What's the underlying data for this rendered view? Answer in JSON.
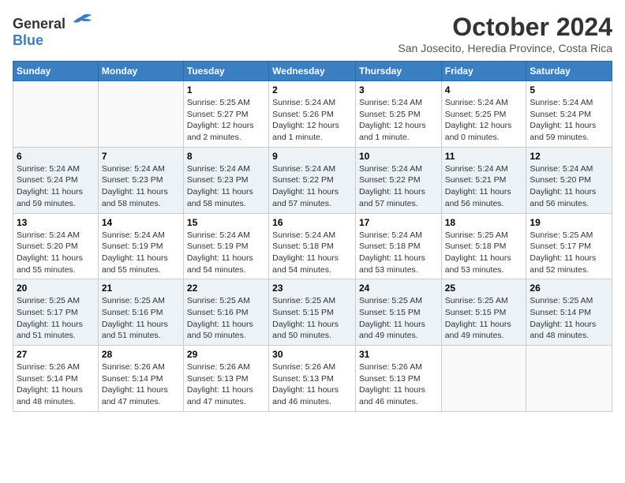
{
  "logo": {
    "general": "General",
    "blue": "Blue"
  },
  "title": "October 2024",
  "location": "San Josecito, Heredia Province, Costa Rica",
  "days_of_week": [
    "Sunday",
    "Monday",
    "Tuesday",
    "Wednesday",
    "Thursday",
    "Friday",
    "Saturday"
  ],
  "weeks": [
    [
      {
        "day": "",
        "detail": ""
      },
      {
        "day": "",
        "detail": ""
      },
      {
        "day": "1",
        "detail": "Sunrise: 5:25 AM\nSunset: 5:27 PM\nDaylight: 12 hours and 2 minutes."
      },
      {
        "day": "2",
        "detail": "Sunrise: 5:24 AM\nSunset: 5:26 PM\nDaylight: 12 hours and 1 minute."
      },
      {
        "day": "3",
        "detail": "Sunrise: 5:24 AM\nSunset: 5:25 PM\nDaylight: 12 hours and 1 minute."
      },
      {
        "day": "4",
        "detail": "Sunrise: 5:24 AM\nSunset: 5:25 PM\nDaylight: 12 hours and 0 minutes."
      },
      {
        "day": "5",
        "detail": "Sunrise: 5:24 AM\nSunset: 5:24 PM\nDaylight: 11 hours and 59 minutes."
      }
    ],
    [
      {
        "day": "6",
        "detail": "Sunrise: 5:24 AM\nSunset: 5:24 PM\nDaylight: 11 hours and 59 minutes."
      },
      {
        "day": "7",
        "detail": "Sunrise: 5:24 AM\nSunset: 5:23 PM\nDaylight: 11 hours and 58 minutes."
      },
      {
        "day": "8",
        "detail": "Sunrise: 5:24 AM\nSunset: 5:23 PM\nDaylight: 11 hours and 58 minutes."
      },
      {
        "day": "9",
        "detail": "Sunrise: 5:24 AM\nSunset: 5:22 PM\nDaylight: 11 hours and 57 minutes."
      },
      {
        "day": "10",
        "detail": "Sunrise: 5:24 AM\nSunset: 5:22 PM\nDaylight: 11 hours and 57 minutes."
      },
      {
        "day": "11",
        "detail": "Sunrise: 5:24 AM\nSunset: 5:21 PM\nDaylight: 11 hours and 56 minutes."
      },
      {
        "day": "12",
        "detail": "Sunrise: 5:24 AM\nSunset: 5:20 PM\nDaylight: 11 hours and 56 minutes."
      }
    ],
    [
      {
        "day": "13",
        "detail": "Sunrise: 5:24 AM\nSunset: 5:20 PM\nDaylight: 11 hours and 55 minutes."
      },
      {
        "day": "14",
        "detail": "Sunrise: 5:24 AM\nSunset: 5:19 PM\nDaylight: 11 hours and 55 minutes."
      },
      {
        "day": "15",
        "detail": "Sunrise: 5:24 AM\nSunset: 5:19 PM\nDaylight: 11 hours and 54 minutes."
      },
      {
        "day": "16",
        "detail": "Sunrise: 5:24 AM\nSunset: 5:18 PM\nDaylight: 11 hours and 54 minutes."
      },
      {
        "day": "17",
        "detail": "Sunrise: 5:24 AM\nSunset: 5:18 PM\nDaylight: 11 hours and 53 minutes."
      },
      {
        "day": "18",
        "detail": "Sunrise: 5:25 AM\nSunset: 5:18 PM\nDaylight: 11 hours and 53 minutes."
      },
      {
        "day": "19",
        "detail": "Sunrise: 5:25 AM\nSunset: 5:17 PM\nDaylight: 11 hours and 52 minutes."
      }
    ],
    [
      {
        "day": "20",
        "detail": "Sunrise: 5:25 AM\nSunset: 5:17 PM\nDaylight: 11 hours and 51 minutes."
      },
      {
        "day": "21",
        "detail": "Sunrise: 5:25 AM\nSunset: 5:16 PM\nDaylight: 11 hours and 51 minutes."
      },
      {
        "day": "22",
        "detail": "Sunrise: 5:25 AM\nSunset: 5:16 PM\nDaylight: 11 hours and 50 minutes."
      },
      {
        "day": "23",
        "detail": "Sunrise: 5:25 AM\nSunset: 5:15 PM\nDaylight: 11 hours and 50 minutes."
      },
      {
        "day": "24",
        "detail": "Sunrise: 5:25 AM\nSunset: 5:15 PM\nDaylight: 11 hours and 49 minutes."
      },
      {
        "day": "25",
        "detail": "Sunrise: 5:25 AM\nSunset: 5:15 PM\nDaylight: 11 hours and 49 minutes."
      },
      {
        "day": "26",
        "detail": "Sunrise: 5:25 AM\nSunset: 5:14 PM\nDaylight: 11 hours and 48 minutes."
      }
    ],
    [
      {
        "day": "27",
        "detail": "Sunrise: 5:26 AM\nSunset: 5:14 PM\nDaylight: 11 hours and 48 minutes."
      },
      {
        "day": "28",
        "detail": "Sunrise: 5:26 AM\nSunset: 5:14 PM\nDaylight: 11 hours and 47 minutes."
      },
      {
        "day": "29",
        "detail": "Sunrise: 5:26 AM\nSunset: 5:13 PM\nDaylight: 11 hours and 47 minutes."
      },
      {
        "day": "30",
        "detail": "Sunrise: 5:26 AM\nSunset: 5:13 PM\nDaylight: 11 hours and 46 minutes."
      },
      {
        "day": "31",
        "detail": "Sunrise: 5:26 AM\nSunset: 5:13 PM\nDaylight: 11 hours and 46 minutes."
      },
      {
        "day": "",
        "detail": ""
      },
      {
        "day": "",
        "detail": ""
      }
    ]
  ]
}
